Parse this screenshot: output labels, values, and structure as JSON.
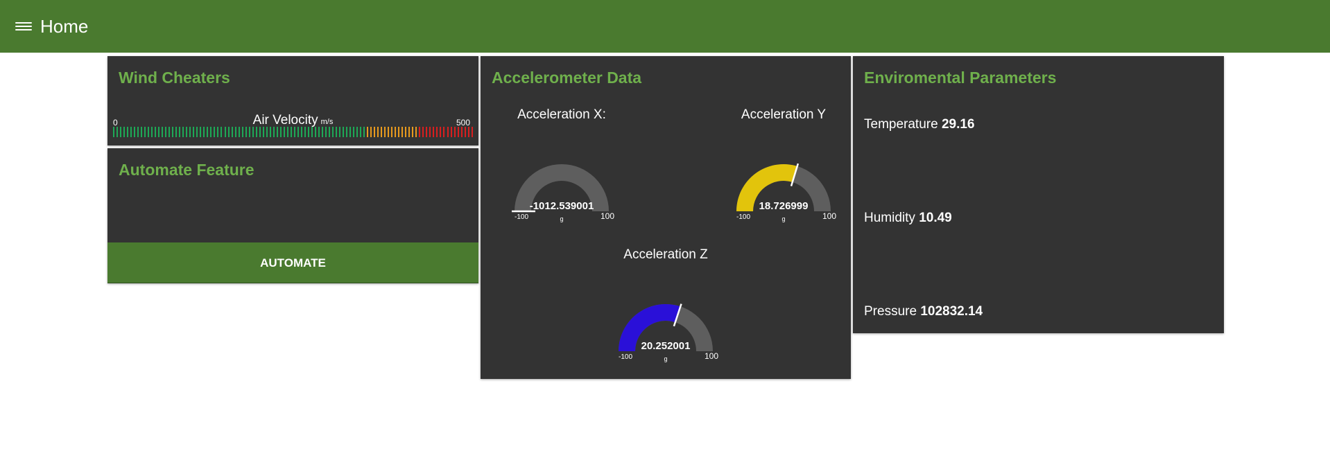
{
  "header": {
    "title": "Home",
    "menu_icon": "hamburger-menu-icon"
  },
  "wind": {
    "title": "Wind Cheaters",
    "gauge": {
      "label": "Air Velocity",
      "unit": "m/s",
      "min": "0",
      "max": "500"
    },
    "colors": {
      "green": "#1ea856",
      "orange": "#e89a1e",
      "red": "#d81f1f"
    }
  },
  "automate": {
    "title": "Automate Feature",
    "button_label": "AUTOMATE"
  },
  "accel": {
    "title": "Accelerometer Data",
    "gauges": [
      {
        "label": "Acceleration X:",
        "value": "-1012.539001",
        "min": "-100",
        "max": "100",
        "unit": "g",
        "color": "#ffffff"
      },
      {
        "label": "Acceleration Y",
        "value": "18.726999",
        "min": "-100",
        "max": "100",
        "unit": "g",
        "color": "#e2c40c"
      },
      {
        "label": "Acceleration Z",
        "value": "20.252001",
        "min": "-100",
        "max": "100",
        "unit": "g",
        "color": "#2a10d8"
      }
    ]
  },
  "env": {
    "title": "Enviromental Parameters",
    "temperature": {
      "label": "Temperature",
      "value": "29.16"
    },
    "humidity": {
      "label": "Humidity",
      "value": "10.49"
    },
    "pressure": {
      "label": "Pressure",
      "value": "102832.14"
    }
  },
  "colors": {
    "header": "#4a7a2f",
    "card": "#333333",
    "title": "#6fb04c",
    "gauge_track": "#5e5e5e"
  }
}
